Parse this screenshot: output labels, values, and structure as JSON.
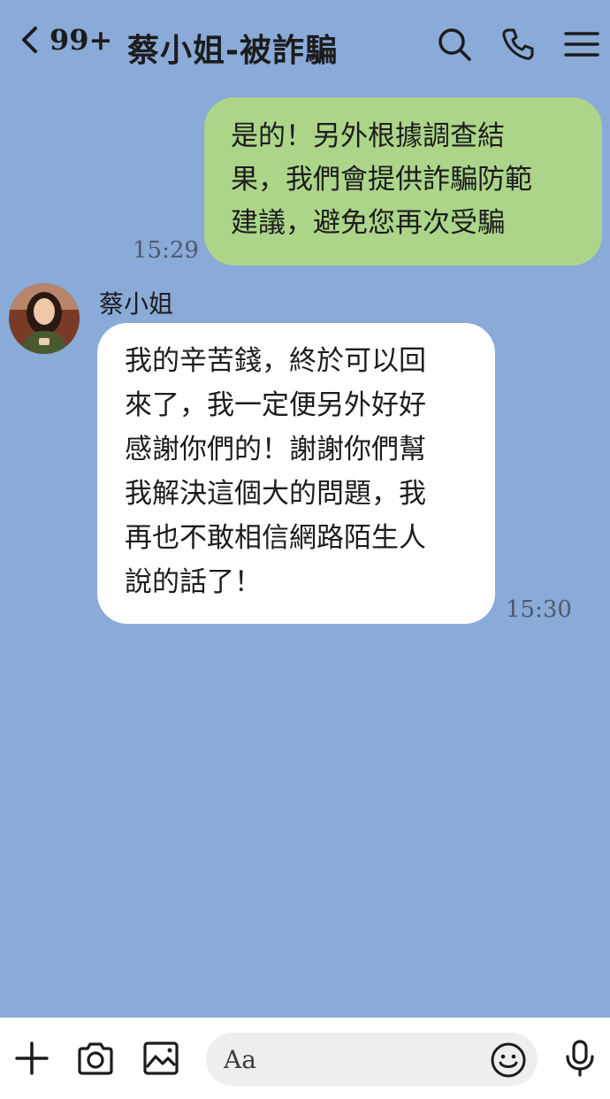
{
  "header": {
    "unread_count": "99+",
    "chat_title": "蔡小姐-被詐騙"
  },
  "messages": {
    "outgoing": {
      "text": "是的！另外根據調查結\n果，我們會提供詐騙防範\n建議，避免您再次受騙",
      "time": "15:29"
    },
    "incoming": {
      "sender": "蔡小姐",
      "text": "我的辛苦錢，終於可以回\n來了，我一定便另外好好\n感謝你們的！謝謝你們幫\n我解決這個大的問題，我\n再也不敢相信網路陌生人\n說的話了！",
      "time": "15:30"
    }
  },
  "composer": {
    "placeholder": "Aa"
  },
  "icons": {
    "back": "chevron-left-icon",
    "search": "search-icon",
    "call": "phone-icon",
    "menu": "menu-icon",
    "add": "plus-icon",
    "camera": "camera-icon",
    "image": "image-icon",
    "emoji": "emoji-icon",
    "mic": "microphone-icon"
  },
  "colors": {
    "background": "#8aaad8",
    "outgoing_bubble": "#acd58a",
    "incoming_bubble": "#ffffff"
  }
}
